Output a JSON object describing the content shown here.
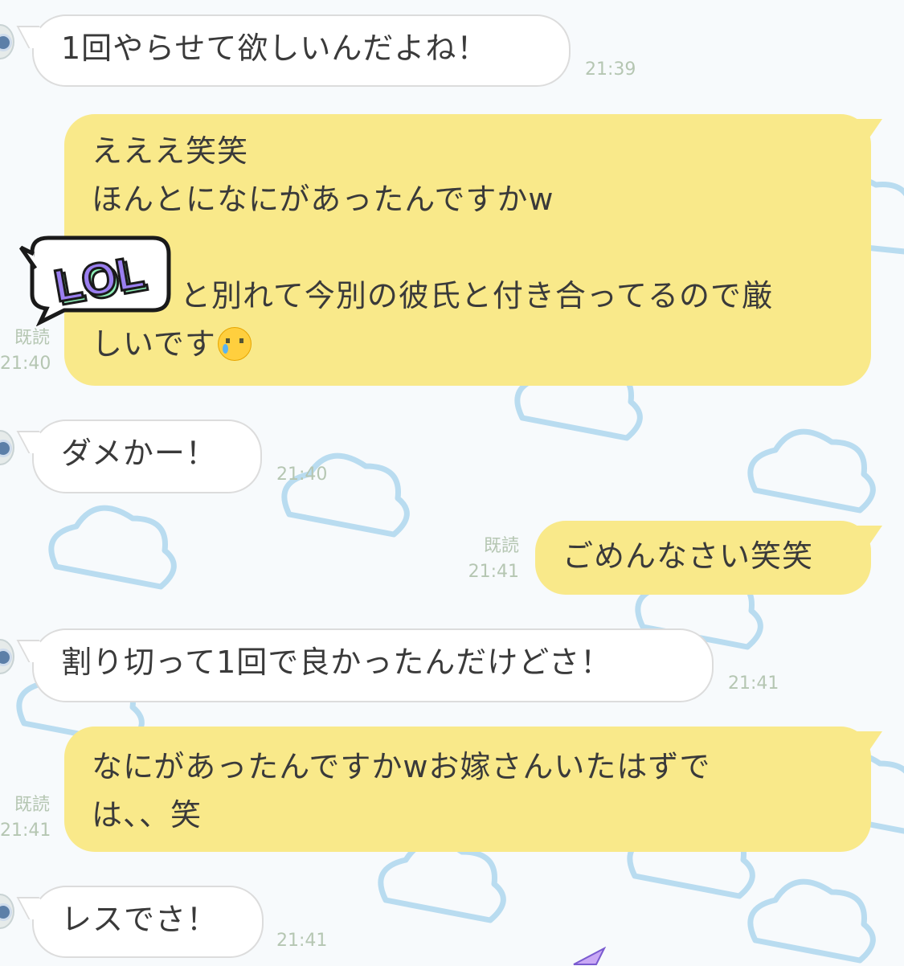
{
  "messages": [
    {
      "id": "m1",
      "from": "other",
      "lines": [
        "1回やらせて欲しいんだよね！"
      ],
      "time": "21:39"
    },
    {
      "id": "m2",
      "from": "me",
      "lines": [
        "えええ笑笑",
        "ほんとになにがあったんですかw",
        "",
        "と別れて今別の彼氏と付き合ってるので厳",
        "しいです"
      ],
      "emoji": "crying-face-emoji",
      "read_label": "既読",
      "time": "21:40"
    },
    {
      "id": "m3",
      "from": "other",
      "lines": [
        "ダメかー！"
      ],
      "time": "21:40"
    },
    {
      "id": "m4",
      "from": "me",
      "lines": [
        "ごめんなさい笑笑"
      ],
      "read_label": "既読",
      "time": "21:41"
    },
    {
      "id": "m5",
      "from": "other",
      "lines": [
        "割り切って1回で良かったんだけどさ！"
      ],
      "time": "21:41"
    },
    {
      "id": "m6",
      "from": "me",
      "lines": [
        "なにがあったんですかwお嫁さんいたはずで",
        "は、、笑"
      ],
      "read_label": "既読",
      "time": "21:41"
    },
    {
      "id": "m7",
      "from": "other",
      "lines": [
        "レスでさ！"
      ],
      "time": "21:41"
    }
  ],
  "sticker": {
    "text": "LOL"
  },
  "colors": {
    "incoming_bubble": "#ffffff",
    "outgoing_bubble": "#f9e98a",
    "timestamp": "#b5c6b2",
    "cloud_outline": "#b9dcf0",
    "sticker_purple": "#9b7ff0",
    "sticker_green": "#8ef0b8"
  }
}
